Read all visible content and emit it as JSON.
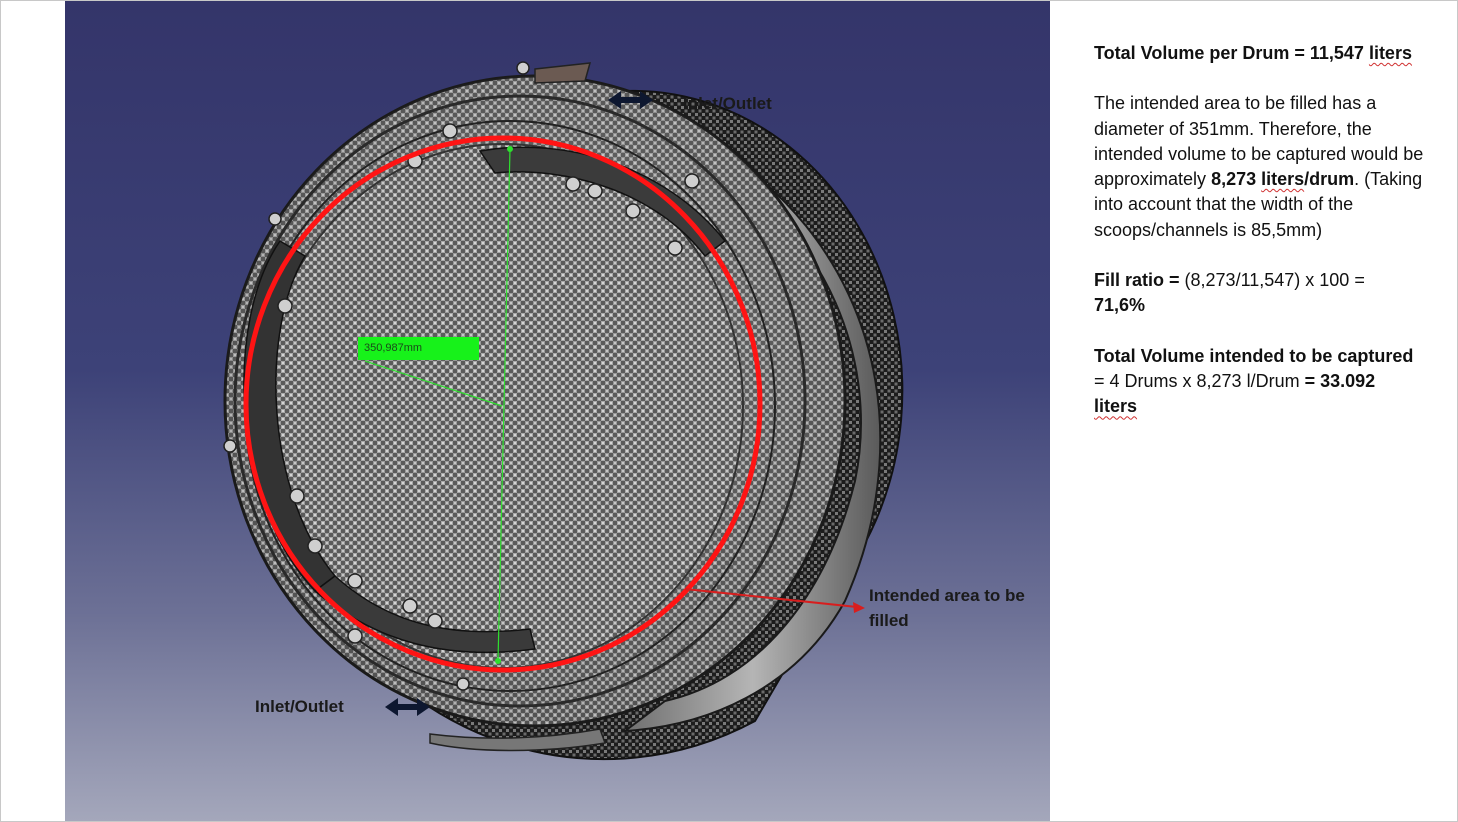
{
  "labels": {
    "inlet_outlet_top": "Inlet/Outlet",
    "inlet_outlet_bottom": "Inlet/Outlet",
    "intended_area": "Intended area to be filled",
    "dimension": "350,987mm"
  },
  "panel": {
    "total_volume": {
      "bold_prefix": "Total Volume per Drum = 11,547 ",
      "bold_word": "liters"
    },
    "intended": {
      "text_1": "The intended area to be filled has a diameter of 351mm. Therefore, the intended volume to be captured would be approximately ",
      "bold_1": "8,273 ",
      "bold_2": "liters",
      "bold_3": "/drum",
      "text_2": ". (Taking into account that the width of the scoops/channels is 85,5mm)"
    },
    "fill_ratio": {
      "bold_label": "Fill ratio = ",
      "formula": "(8,273/11,547) x 100 =",
      "result": "71,6%"
    },
    "total_captured": {
      "bold_label": "Total Volume intended to be captured",
      "text_1": "= 4 Drums x 8,273 l/Drum ",
      "bold_result": "= 33.092",
      "bold_unit": "liters"
    }
  },
  "colors": {
    "background_top": "#34356a",
    "background_bottom": "#a4a7bb",
    "highlight_circle": "#ff1414",
    "dimension_box": "#17f21a",
    "arrow": "#d81e1e"
  },
  "icons": [
    "double-arrow-icon",
    "double-arrow-icon"
  ]
}
